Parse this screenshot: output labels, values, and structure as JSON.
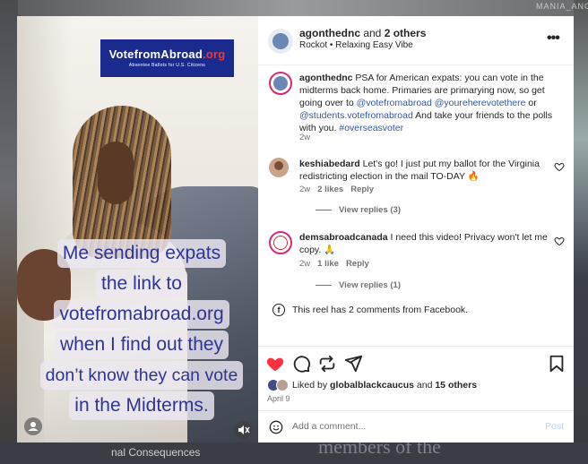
{
  "background": {
    "right_text": "MANIA_ANGEL",
    "bottom_left_text": "nal Consequences",
    "bottom_big_text": "members of the"
  },
  "media": {
    "badge_title_part1": "VotefromAbroad",
    "badge_title_part2": ".org",
    "badge_subtitle": "Absentee Ballots for U.S. Citizens",
    "caption_lines": [
      "Me sending expats",
      "the link to",
      "votefromabroad.org",
      "when I find out they",
      "don’t know they can vote",
      "in the Midterms."
    ]
  },
  "header": {
    "username": "agonthednc",
    "and_text": " and ",
    "others": "2 others",
    "audio": "Rockot • Relaxing Easy Vibe"
  },
  "caption_post": {
    "username": "agonthednc",
    "text_1": " PSA for American expats: you can vote in the midterms back home. Primaries are primarying now, so get going over to ",
    "mention_1": "@votefromabroad",
    "text_2": " ",
    "mention_2": "@youreherevotethere",
    "text_3": " or ",
    "mention_3": "@students.votefromabroad",
    "text_4": " And take your friends to the polls with you. ",
    "hashtag": "#overseasvoter",
    "time": "2w"
  },
  "comments": [
    {
      "username": "keshiabedard",
      "text": " Let's go! I just put my ballot for the Virginia redistricting election in the mail TO-DAY 🔥",
      "time": "2w",
      "likes": "2 likes",
      "reply": "Reply",
      "view_replies": "View replies (3)"
    },
    {
      "username": "demsabroadcanada",
      "text": " I need this video! Privacy won't let me copy. 🙏",
      "time": "2w",
      "likes": "1 like",
      "reply": "Reply",
      "view_replies": "View replies (1)"
    }
  ],
  "facebook_note": "This reel has 2 comments from Facebook.",
  "likes": {
    "prefix": "Liked by ",
    "user": "globalblackcaucus",
    "and": " and ",
    "others": "15 others"
  },
  "date": "April 9",
  "add_comment": {
    "placeholder": "Add a comment...",
    "post_label": "Post"
  },
  "colors": {
    "heart": "#ff3040",
    "mention": "#2e5aa8",
    "badge": "#1b2a8f",
    "caption_text": "#2e3590"
  }
}
